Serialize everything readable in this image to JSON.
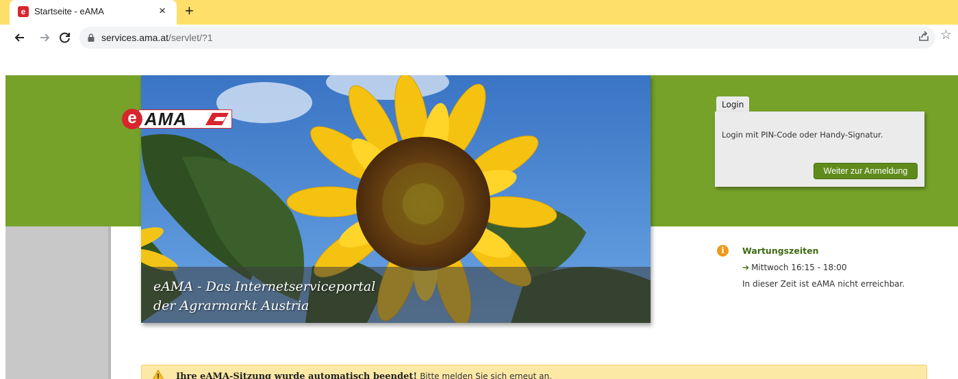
{
  "browser": {
    "tab_title": "Startseite - eAMA",
    "tab_close": "×",
    "new_tab": "+",
    "url_host": "services.ama.at",
    "url_path": "/servlet/?1",
    "icons": [
      "back-arrow-icon",
      "forward-arrow-icon",
      "reload-icon",
      "lock-icon",
      "share-icon",
      "star-icon"
    ]
  },
  "colors": {
    "tabbar": "#fedf6a",
    "green_band": "#76a22a",
    "brand_red": "#d7262e",
    "button_green": "#5f8b1c",
    "warning_bg": "#fde9a6",
    "info_orange": "#ef9a1a"
  },
  "header": {
    "logo_prefix": "e",
    "logo_text": "AMA",
    "hero_line1": "eAMA - Das Internetserviceportal",
    "hero_line2": "der Agrarmarkt Austria"
  },
  "login": {
    "tab_label": "Login",
    "text": "Login mit PIN-Code oder Handy-Signatur.",
    "button_label": "Weiter zur Anmeldung"
  },
  "maintenance": {
    "title": "Wartungszeiten",
    "arrow": "➔",
    "time": "Mittwoch 16:15 - 18:00",
    "note": "In dieser Zeit ist eAMA nicht erreichbar."
  },
  "warning": {
    "bold_text": "Ihre eAMA-Sitzung wurde automatisch beendet!",
    "text": "Bitte melden Sie sich erneut an."
  }
}
